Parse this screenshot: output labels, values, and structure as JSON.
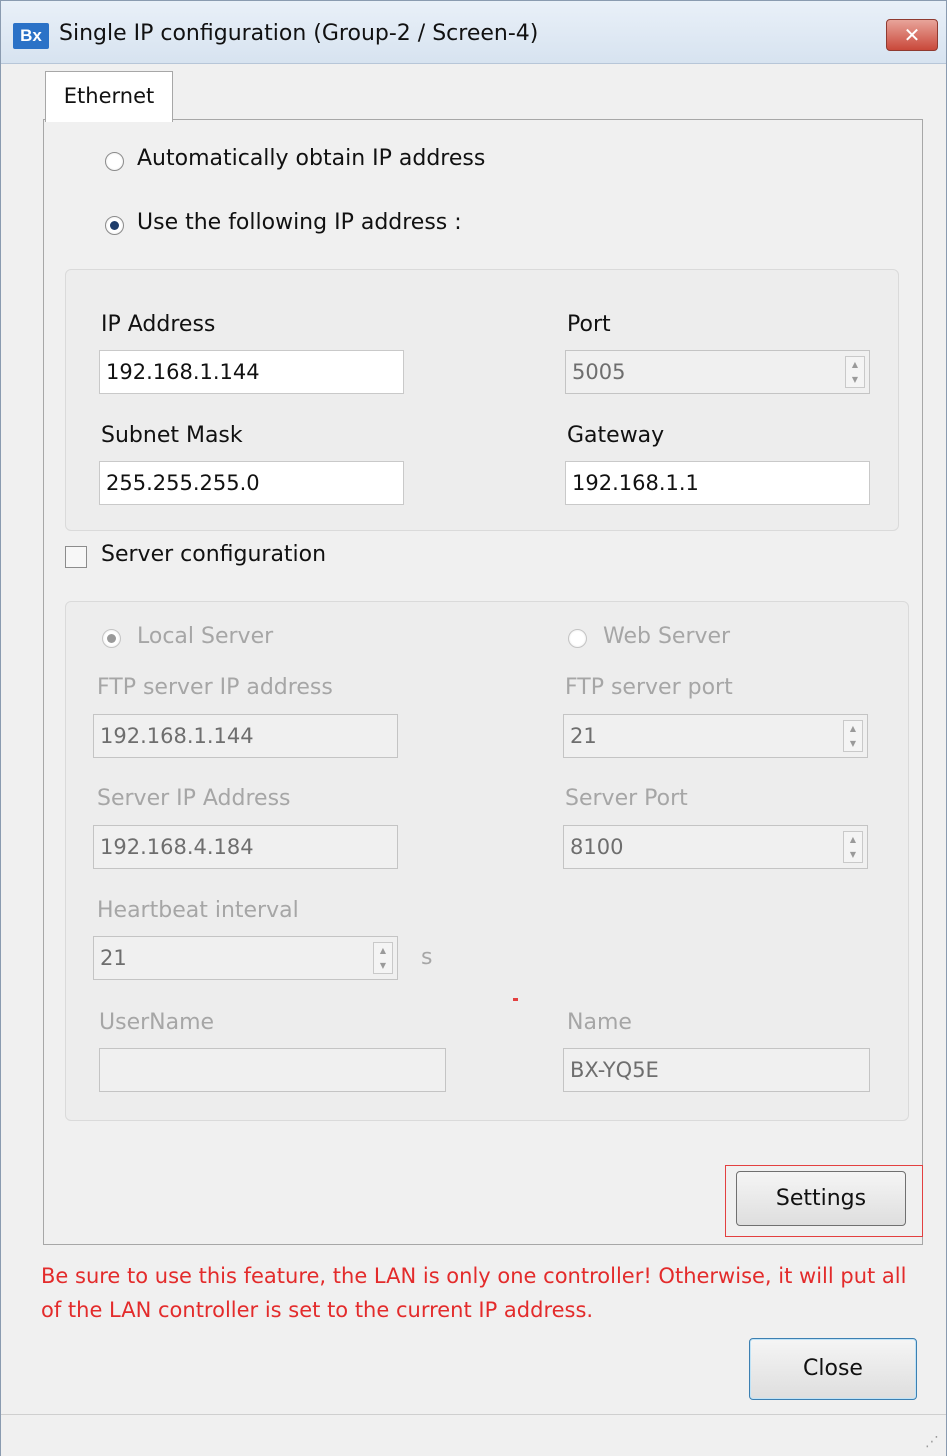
{
  "window": {
    "title": "Single IP configuration   (Group-2 / Screen-4)",
    "app_icon_text": "Bx",
    "close_glyph": "✕"
  },
  "tabs": [
    {
      "label": "Ethernet"
    }
  ],
  "ip_mode": {
    "auto_label": "Automatically obtain IP address",
    "manual_label": "Use the following IP address :",
    "selected": "manual"
  },
  "network": {
    "ip_label": "IP Address",
    "ip_value": "192.168.1.144",
    "port_label": "Port",
    "port_value": "5005",
    "subnet_label": "Subnet Mask",
    "subnet_value": "255.255.255.0",
    "gateway_label": "Gateway",
    "gateway_value": "192.168.1.1"
  },
  "server": {
    "checkbox_label": "Server configuration",
    "checked": false,
    "local_label": "Local Server",
    "web_label": "Web Server",
    "ftp_ip_label": "FTP server IP address",
    "ftp_ip_value": "192.168.1.144",
    "ftp_port_label": "FTP server port",
    "ftp_port_value": "21",
    "server_ip_label": "Server IP Address",
    "server_ip_value": "192.168.4.184",
    "server_port_label": "Server Port",
    "server_port_value": "8100",
    "heartbeat_label": "Heartbeat interval",
    "heartbeat_value": "21",
    "heartbeat_unit": "s",
    "username_label": "UserName",
    "username_value": "",
    "name_label": "Name",
    "name_value": "BX-YQ5E"
  },
  "buttons": {
    "settings": "Settings",
    "close": "Close"
  },
  "warning": "Be sure to use this feature, the LAN is only one controller! Otherwise, it will put all of the LAN controller is set to the current IP address.",
  "colors": {
    "warning": "#e32b2b",
    "highlight_border": "#e34040",
    "title_bar": "#dbe6f2"
  },
  "icons": {
    "resize_grip": "⋰"
  }
}
